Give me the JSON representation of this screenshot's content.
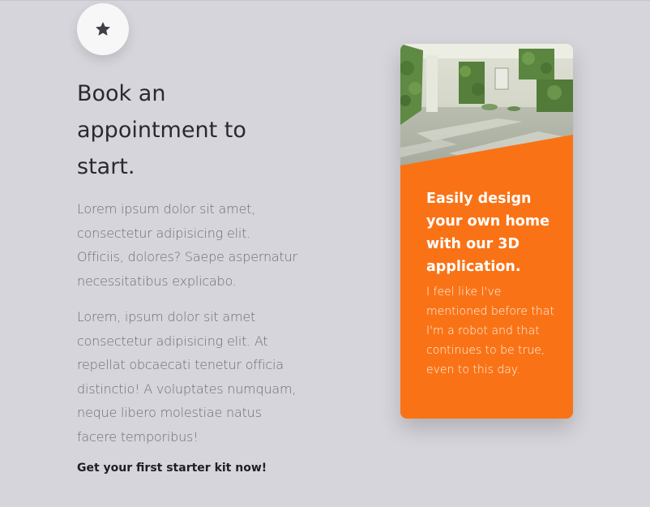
{
  "intro": {
    "icon": "star-icon",
    "heading": "Book an appointment to start.",
    "paragraphs": [
      "Lorem ipsum dolor sit amet, consectetur adipisicing elit. Officiis, dolores? Saepe aspernatur necessitatibus explicabo.",
      "Lorem, ipsum dolor sit amet consectetur adipisicing elit. At repellat obcaecati tenetur officia distinctio! A voluptates numquam, neque libero molestiae natus facere temporibus!"
    ],
    "cta": "Get your first starter kit now!"
  },
  "card": {
    "image": "interior-room-with-green-walls",
    "title": "Easily design your own home with our 3D application.",
    "text": "I feel like I've mentioned before that I'm a robot and that continues to be true, even to this day.",
    "accent_color": "#f97316"
  }
}
